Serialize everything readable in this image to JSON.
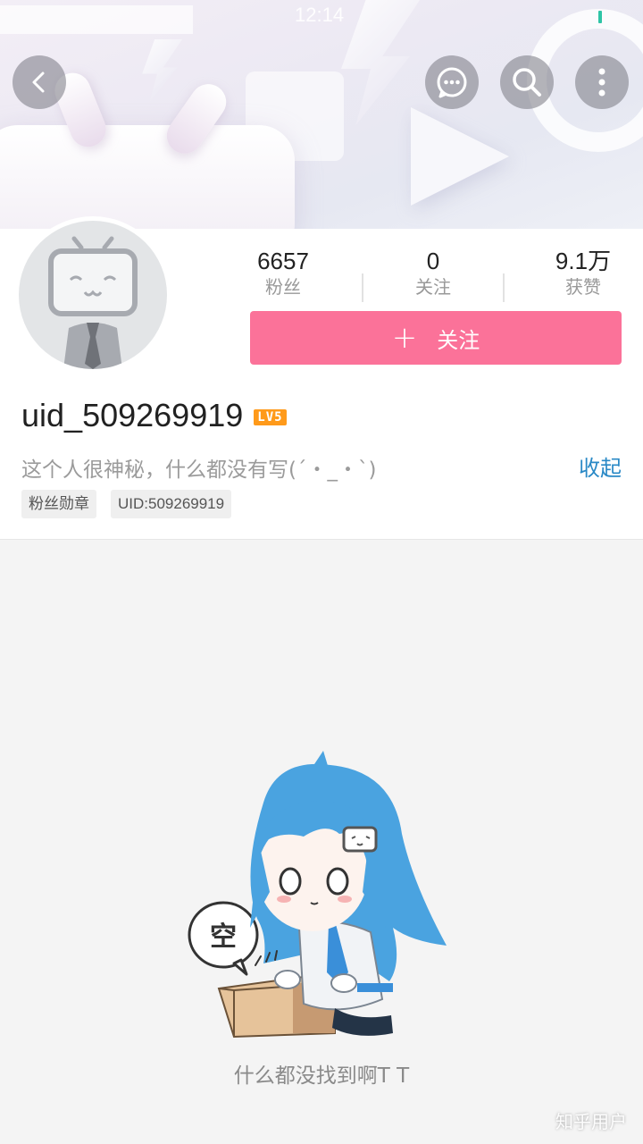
{
  "status_bar": {
    "time": "12:14"
  },
  "profile": {
    "stats": [
      {
        "value": "6657",
        "label": "粉丝"
      },
      {
        "value": "0",
        "label": "关注"
      },
      {
        "value": "9.1万",
        "label": "获赞"
      }
    ],
    "follow_button_label": "关注",
    "follow_button_icon": "plus-icon",
    "username": "uid_509269919",
    "level": "LV5",
    "signature": "这个人很神秘，什么都没有写(´・_・`)",
    "collapse_label": "收起",
    "tags": [
      "粉丝勋章",
      "UID:509269919"
    ]
  },
  "empty_state": {
    "bubble_text": "空",
    "message": "什么都没找到啊T T"
  },
  "watermark": "知乎用户",
  "colors": {
    "accent": "#fb7299",
    "link": "#2a89c6",
    "level": "#ff9a1a"
  },
  "icons": {
    "back": "back-arrow-icon",
    "message": "message-icon",
    "search": "search-icon",
    "more": "more-icon"
  }
}
